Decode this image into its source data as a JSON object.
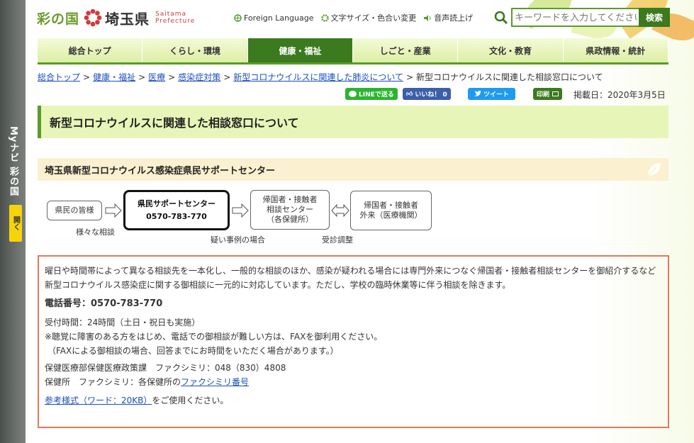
{
  "sidebar": {
    "myna_label": "Myナビ 彩の国",
    "open_label": "開く"
  },
  "header": {
    "logo_sai": "彩の国",
    "logo_pref": "埼玉県",
    "logo_en_1": "Saitama",
    "logo_en_2": "Prefecture",
    "foreign_language": "Foreign Language",
    "font_color": "文字サイズ・色合い変更",
    "speech": "音声読上げ",
    "search_placeholder": "キーワードを入力してください",
    "search_button": "検索"
  },
  "nav": [
    "総合トップ",
    "くらし・環境",
    "健康・福祉",
    "しごと・産業",
    "文化・教育",
    "県政情報・統計"
  ],
  "breadcrumb": {
    "items": [
      "総合トップ",
      "健康・福祉",
      "医療",
      "感染症対策",
      "新型コロナウイルスに関連した肺炎について"
    ],
    "current": "新型コロナウイルスに関連した相談窓口について"
  },
  "share": {
    "line": "LINEで送る",
    "like": "いいね！ 0",
    "tweet": "ツイート",
    "print": "印刷"
  },
  "date": "掲載日：2020年3月5日",
  "page_title": "新型コロナウイルスに関連した相談窓口について",
  "section_title": "埼玉県新型コロナウイルス感染症県民サポートセンター",
  "flow": {
    "citizens": "県民の皆様",
    "center_name": "県民サポートセンター",
    "center_phone": "0570-783-770",
    "returnee_center_1": "帰国者・接触者",
    "returnee_center_2": "相談センター",
    "returnee_center_3": "（各保健所）",
    "returnee_clinic_1": "帰国者・接触者",
    "returnee_clinic_2": "外来（医療機関）",
    "label_various": "様々な相談",
    "label_suspected": "疑い事例の場合",
    "label_adjust": "受診調整"
  },
  "info": {
    "description": "曜日や時間帯によって異なる相談先を一本化し、一般的な相談のほか、感染が疑われる場合には専門外来につなぐ帰国者・接触者相談センターを御紹介するなど新型コロナウイルス感染症に関する御相談に一元的に対応しています。ただし、学校の臨時休業等に伴う相談を除きます。",
    "phone_label": "電話番号：",
    "phone": "0570-783-770",
    "hours": "受付時間：24時間（土日・祝日も実施）",
    "fax_note_1": "※聴覚に障害のある方をはじめ、電話での御相談が難しい方は、FAXを御利用ください。",
    "fax_note_2": "（FAXによる御相談の場合、回答までにお時間をいただく場合があります。）",
    "fax_dept": "保健医療部保健医療政策課　ファクシミリ：048（830）4808",
    "fax_hc_prefix": "保健所　ファクシミリ：各保健所の",
    "fax_hc_link": "ファクシミリ番号",
    "form_link": "参考様式（ワード：20KB）",
    "form_suffix": "をご使用ください。"
  }
}
